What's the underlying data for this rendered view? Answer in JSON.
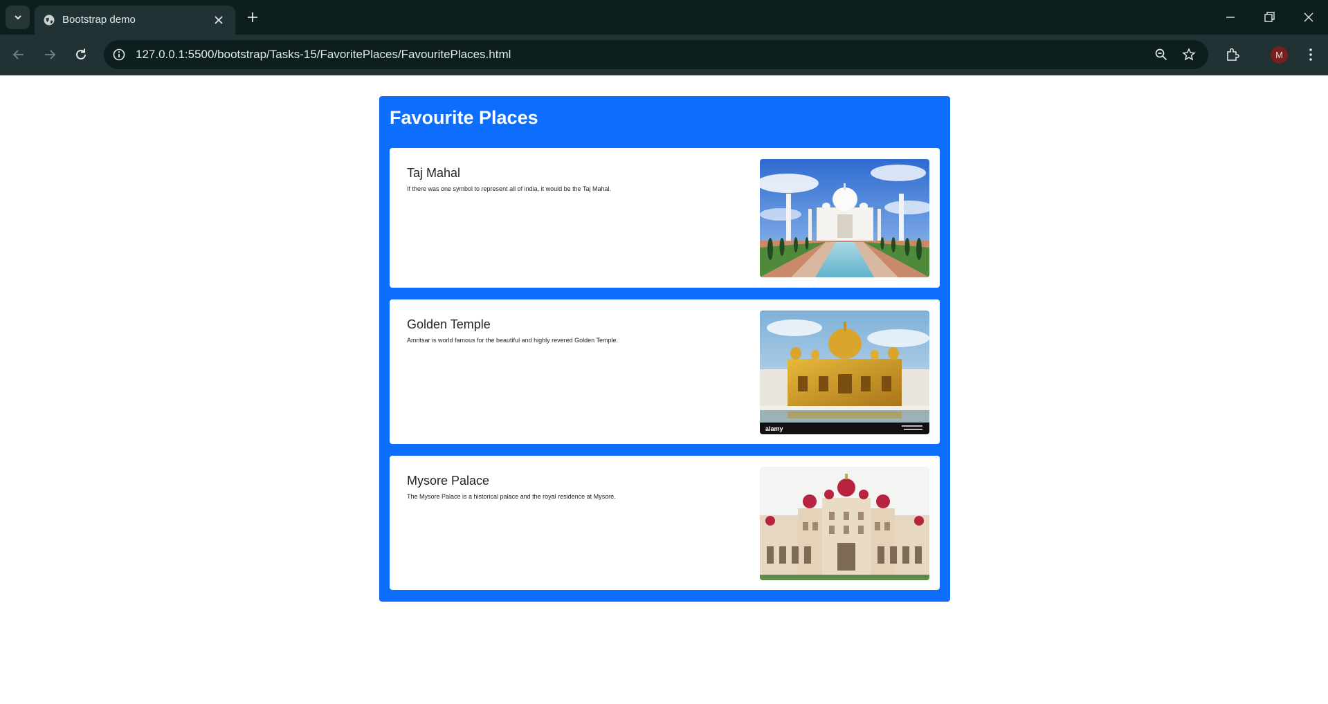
{
  "browser": {
    "tab_title": "Bootstrap demo",
    "url": "127.0.0.1:5500/bootstrap/Tasks-15/FavoritePlaces/FavouritePlaces.html",
    "profile_initial": "M"
  },
  "page": {
    "title": "Favourite Places",
    "accent_color": "#0d6efd",
    "cards": [
      {
        "title": "Taj Mahal",
        "text": "If there was one symbol to represent all of india, it would be the Taj Mahal.",
        "image": "taj-mahal-photo"
      },
      {
        "title": "Golden Temple",
        "text": "Amritsar is world famous for the beautiful and highly revered Golden Temple.",
        "image": "golden-temple-photo",
        "watermark": "alamy"
      },
      {
        "title": "Mysore Palace",
        "text": "The Mysore Palace is a historical palace and the royal residence at Mysore.",
        "image": "mysore-palace-photo"
      }
    ]
  }
}
